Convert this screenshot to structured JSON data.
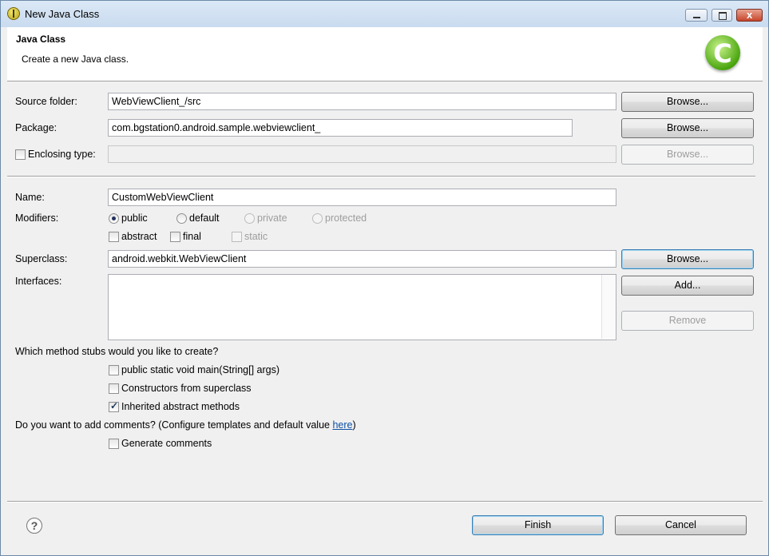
{
  "window": {
    "title": "New Java Class",
    "minimize_icon": "minimize-icon",
    "maximize_icon": "maximize-icon",
    "close_icon": "close-icon",
    "close_glyph": "x"
  },
  "header": {
    "title": "Java Class",
    "description": "Create a new Java class.",
    "icon": "java-class-icon",
    "icon_glyph": "C"
  },
  "form": {
    "source_folder": {
      "label": "Source folder:",
      "value": "WebViewClient_/src",
      "browse": "Browse..."
    },
    "package": {
      "label": "Package:",
      "value": "com.bgstation0.android.sample.webviewclient_",
      "browse": "Browse..."
    },
    "enclosing_type": {
      "label": "Enclosing type:",
      "checked": false,
      "value": "",
      "browse": "Browse..."
    },
    "name": {
      "label": "Name:",
      "value": "CustomWebViewClient"
    },
    "modifiers": {
      "label": "Modifiers:",
      "access": [
        {
          "label": "public",
          "selected": true,
          "enabled": true
        },
        {
          "label": "default",
          "selected": false,
          "enabled": true
        },
        {
          "label": "private",
          "selected": false,
          "enabled": false
        },
        {
          "label": "protected",
          "selected": false,
          "enabled": false
        }
      ],
      "flags": [
        {
          "label": "abstract",
          "checked": false,
          "enabled": true
        },
        {
          "label": "final",
          "checked": false,
          "enabled": true
        },
        {
          "label": "static",
          "checked": false,
          "enabled": false
        }
      ]
    },
    "superclass": {
      "label": "Superclass:",
      "value": "android.webkit.WebViewClient",
      "browse": "Browse..."
    },
    "interfaces": {
      "label": "Interfaces:",
      "items": [],
      "add": "Add...",
      "remove": "Remove"
    },
    "stubs": {
      "question": "Which method stubs would you like to create?",
      "options": [
        {
          "label": "public static void main(String[] args)",
          "checked": false
        },
        {
          "label": "Constructors from superclass",
          "checked": false
        },
        {
          "label": "Inherited abstract methods",
          "checked": true
        }
      ]
    },
    "comments": {
      "question_prefix": "Do you want to add comments? (Configure templates and default value ",
      "link": "here",
      "question_suffix": ")",
      "option": {
        "label": "Generate comments",
        "checked": false
      }
    }
  },
  "footer": {
    "help_icon": "help-icon",
    "help_glyph": "?",
    "finish": "Finish",
    "cancel": "Cancel"
  }
}
